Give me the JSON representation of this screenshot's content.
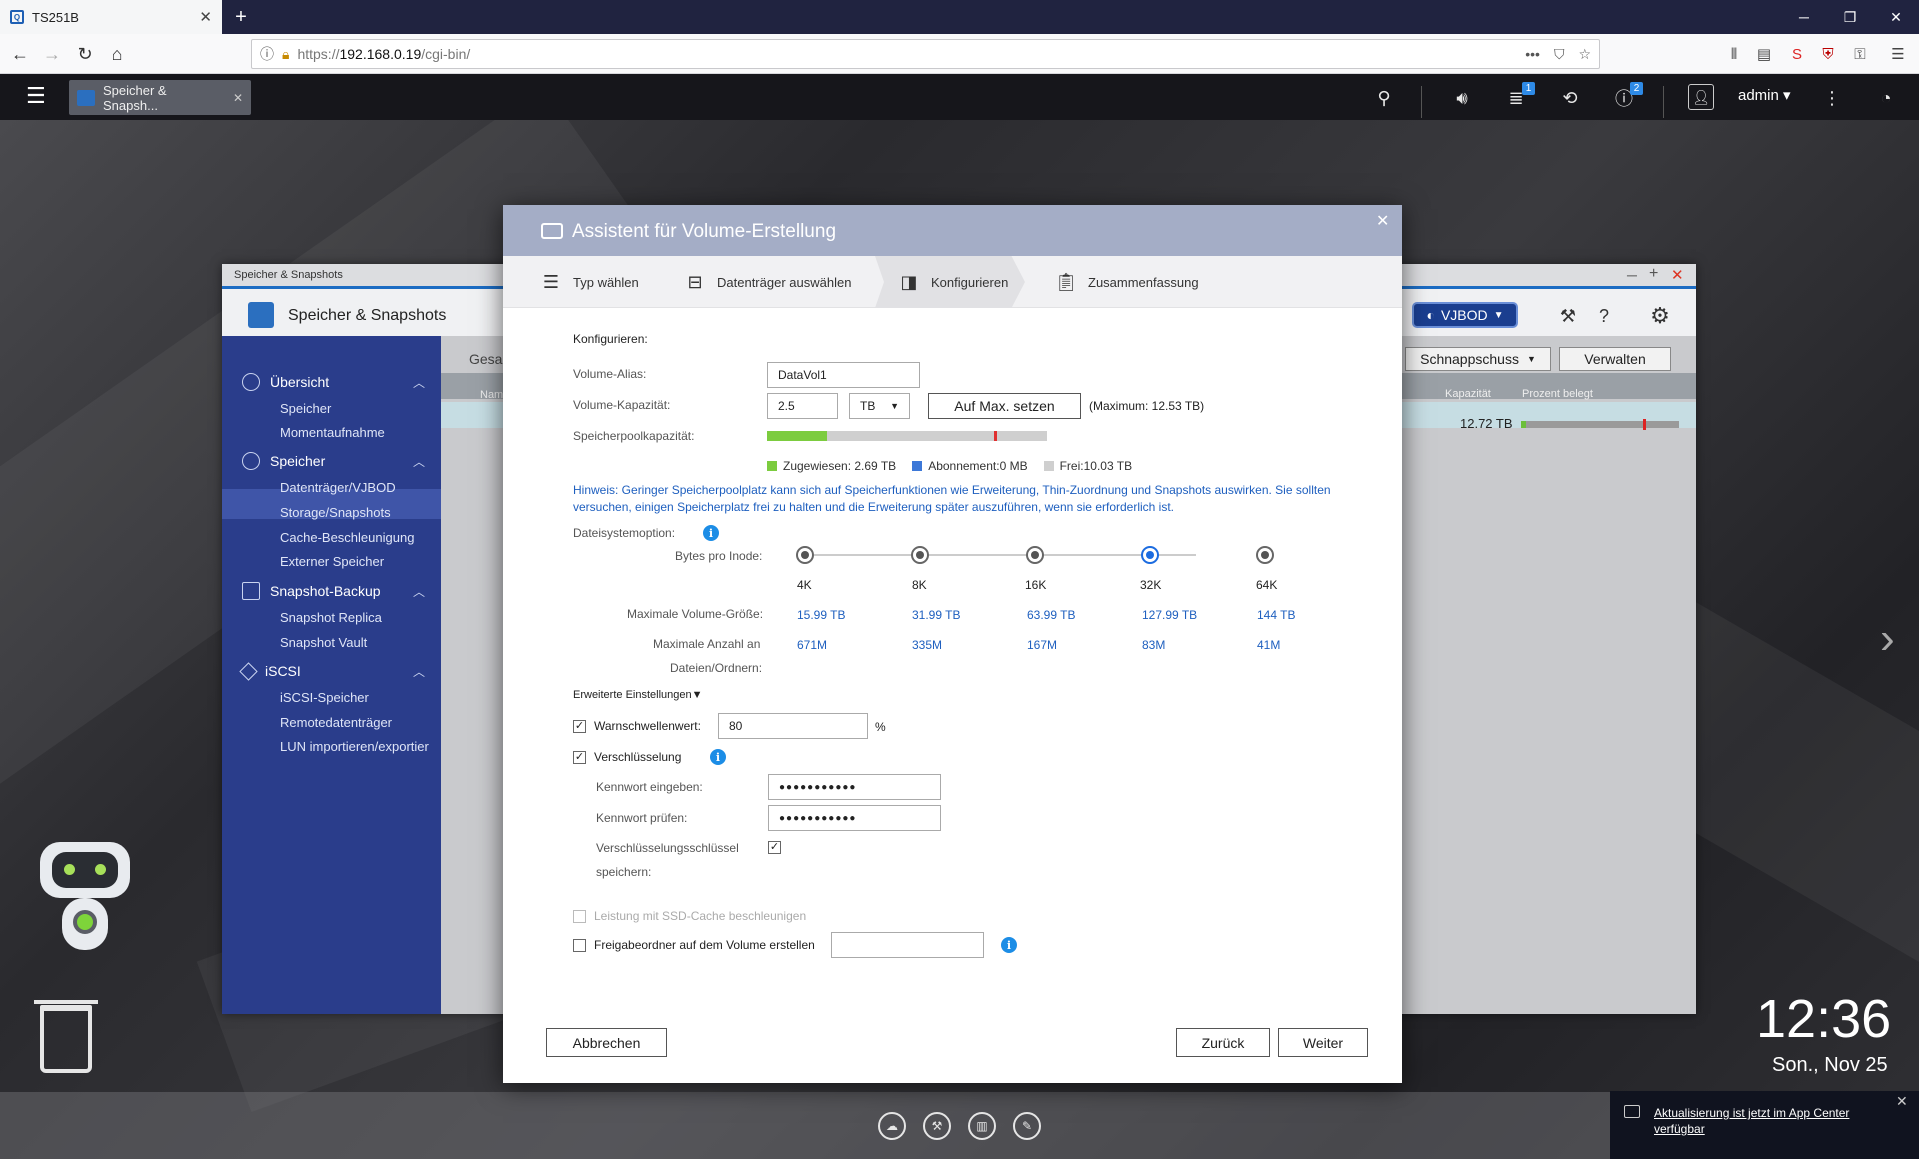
{
  "browser": {
    "tab_title": "TS251B",
    "tab_close": "✕",
    "new_tab": "+",
    "url_https": "https://",
    "url_host": "192.168.0.19",
    "url_path": "/cgi-bin/",
    "window_min": "─",
    "window_restore": "❐",
    "window_close": "✕"
  },
  "qts": {
    "app_tab": "Speicher & Snapsh...",
    "app_tab_close": "✕",
    "user": "admin ▾",
    "badge_tasks": "1",
    "badge_info": "2"
  },
  "bg_window": {
    "titlebar": "Speicher & Snapshots",
    "app_name": "Speicher & Snapshots",
    "vjbod": "VJBOD",
    "snapshot_btn": "Schnappschuss",
    "manage_btn": "Verwalten",
    "main_heading": "Gesa",
    "col_name": "Nam",
    "col_capacity": "Kapazität",
    "col_percent": "Prozent belegt",
    "row_capacity": "12.72 TB",
    "sidebar": [
      {
        "heading": "Übersicht",
        "items": [
          "Speicher",
          "Momentaufnahme"
        ]
      },
      {
        "heading": "Speicher",
        "items": [
          "Datenträger/VJBOD",
          "Storage/Snapshots",
          "Cache-Beschleunigung",
          "Externer Speicher"
        ]
      },
      {
        "heading": "Snapshot-Backup",
        "items": [
          "Snapshot Replica",
          "Snapshot Vault"
        ]
      },
      {
        "heading": "iSCSI",
        "items": [
          "iSCSI-Speicher",
          "Remotedatenträger",
          "LUN importieren/exportier"
        ]
      }
    ]
  },
  "dialog": {
    "title": "Assistent für Volume-Erstellung",
    "close": "✕",
    "steps": [
      "Typ wählen",
      "Datenträger auswählen",
      "Konfigurieren",
      "Zusammenfassung"
    ],
    "section": "Konfigurieren:",
    "alias_label": "Volume-Alias:",
    "alias_value": "DataVol1",
    "capacity_label": "Volume-Kapazität:",
    "capacity_value": "2.5",
    "capacity_unit": "TB",
    "max_button": "Auf Max. setzen",
    "max_text": "(Maximum: 12.53 TB)",
    "pool_label": "Speicherpoolkapazität:",
    "pool_allocated_fraction": 0.215,
    "pool_marker_fraction": 0.81,
    "legend": {
      "allocated": "Zugewiesen: 2.69 TB",
      "subscription": "Abonnement:0 MB",
      "free": "Frei:10.03 TB",
      "color_allocated": "#7ccc3f",
      "color_subscription": "#3c78d8",
      "color_free": "#cfcfcf"
    },
    "hint": "Hinweis: Geringer Speicherpoolplatz kann sich auf Speicherfunktionen wie Erweiterung, Thin-Zuordnung und Snapshots auswirken. Sie sollten versuchen, einigen Speicherplatz frei zu halten und die Erweiterung später auszuführen, wenn sie erforderlich ist.",
    "fs_label": "Dateisystemoption:",
    "bytes_label": "Bytes pro Inode:",
    "inode_options": [
      "4K",
      "8K",
      "16K",
      "32K",
      "64K"
    ],
    "selected_inode": "32K",
    "max_size_label": "Maximale Volume-Größe:",
    "max_sizes": [
      "15.99 TB",
      "31.99 TB",
      "63.99 TB",
      "127.99 TB",
      "144 TB"
    ],
    "max_files_label_1": "Maximale Anzahl an",
    "max_files_label_2": "Dateien/Ordnern:",
    "max_files": [
      "671M",
      "335M",
      "167M",
      "83M",
      "41M"
    ],
    "advanced": "Erweiterte Einstellungen▼",
    "warn_label": "Warnschwellenwert:",
    "warn_value": "80",
    "warn_unit": "%",
    "encryption_label": "Verschlüsselung",
    "pw_label": "Kennwort eingeben:",
    "pw_value": "●●●●●●●●●●●",
    "pw2_label": "Kennwort prüfen:",
    "pw2_value": "●●●●●●●●●●●",
    "savekey_label_1": "Verschlüsselungsschlüssel",
    "savekey_label_2": "speichern:",
    "ssd_label": "Leistung mit SSD-Cache beschleunigen",
    "share_label": "Freigabeordner auf dem Volume erstellen",
    "share_value": "",
    "cancel": "Abbrechen",
    "back": "Zurück",
    "next": "Weiter",
    "check_mark": "✓",
    "info_glyph": "i"
  },
  "desktop": {
    "time": "12:36",
    "date": "Son., Nov 25",
    "notification": "Aktualisierung ist jetzt im App Center verfügbar",
    "notification_close": "✕"
  }
}
